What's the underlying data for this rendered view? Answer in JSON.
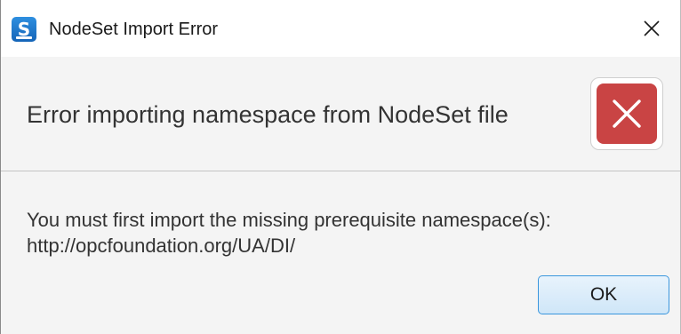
{
  "window": {
    "title": "NodeSet Import Error",
    "app_icon": "S",
    "close_icon": "close-icon"
  },
  "header": {
    "message": "Error importing namespace from NodeSet file",
    "icon": "error-icon",
    "icon_color": "#c94444"
  },
  "body": {
    "line1": "You must first import the missing prerequisite namespace(s):",
    "line2": "http://opcfoundation.org/UA/DI/"
  },
  "buttons": {
    "ok_label": "OK",
    "accent": "#3a96dd"
  }
}
